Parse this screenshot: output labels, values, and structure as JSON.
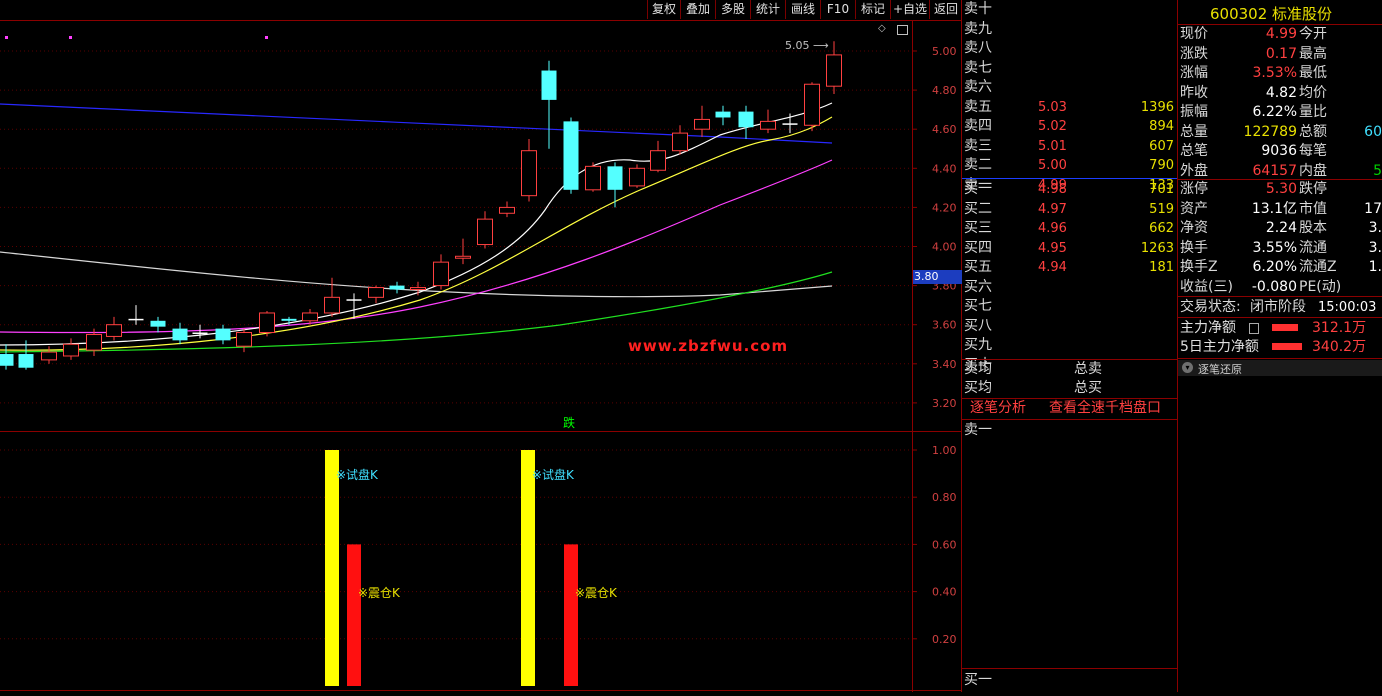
{
  "toolbar": {
    "buttons": [
      "复权",
      "叠加",
      "多股",
      "统计",
      "画线",
      "F10",
      "标记",
      "+自选",
      "返回"
    ]
  },
  "main_chart": {
    "price_axis": [
      "5.00",
      "4.80",
      "4.60",
      "4.40",
      "4.20",
      "4.00",
      "3.80",
      "3.60",
      "3.40",
      "3.20"
    ],
    "current_price_tag": "3.80",
    "high_annotation": "5.05",
    "watermark": "www.zbzfwu.com",
    "marker_text": "跌"
  },
  "indicator": {
    "axis": [
      "1.00",
      "0.80",
      "0.60",
      "0.40",
      "0.20"
    ],
    "label_trial": "※试盘K",
    "label_shake": "※震仓K"
  },
  "order_book": {
    "sell_empty": [
      "卖十",
      "卖九",
      "卖八",
      "卖七",
      "卖六"
    ],
    "sells": [
      {
        "label": "卖五",
        "price": "5.03",
        "vol": "1396"
      },
      {
        "label": "卖四",
        "price": "5.02",
        "vol": "894"
      },
      {
        "label": "卖三",
        "price": "5.01",
        "vol": "607"
      },
      {
        "label": "卖二",
        "price": "5.00",
        "vol": "790"
      },
      {
        "label": "卖一",
        "price": "4.99",
        "vol": "133"
      }
    ],
    "buys": [
      {
        "label": "买一",
        "price": "4.98",
        "vol": "701"
      },
      {
        "label": "买二",
        "price": "4.97",
        "vol": "519"
      },
      {
        "label": "买三",
        "price": "4.96",
        "vol": "662"
      },
      {
        "label": "买四",
        "price": "4.95",
        "vol": "1263"
      },
      {
        "label": "买五",
        "price": "4.94",
        "vol": "181"
      }
    ],
    "buy_empty": [
      "买六",
      "买七",
      "买八",
      "买九",
      "买十"
    ],
    "avg_sell": "卖均",
    "total_sell": "总卖",
    "avg_buy": "买均",
    "total_buy": "总买",
    "tab_tick_analysis": "逐笔分析",
    "tab_full_depth": "查看全速千档盘口",
    "sub_sell1": "卖一",
    "sub_buy1": "买一"
  },
  "quote": {
    "code": "600302",
    "name": "标准股份",
    "rows": [
      {
        "l1": "现价",
        "v1": "4.99",
        "c1": "red",
        "l2": "今开",
        "v2": ""
      },
      {
        "l1": "涨跌",
        "v1": "0.17",
        "c1": "red",
        "l2": "最高",
        "v2": ""
      },
      {
        "l1": "涨幅",
        "v1": "3.53%",
        "c1": "red",
        "l2": "最低",
        "v2": ""
      },
      {
        "l1": "昨收",
        "v1": "4.82",
        "c1": "wht",
        "l2": "均价",
        "v2": ""
      },
      {
        "l1": "振幅",
        "v1": "6.22%",
        "c1": "wht",
        "l2": "量比",
        "v2": ""
      },
      {
        "l1": "总量",
        "v1": "122789",
        "c1": "yel",
        "l2": "总额",
        "v2": "60",
        "c2": "cy"
      },
      {
        "l1": "总笔",
        "v1": "9036",
        "c1": "wht",
        "l2": "每笔",
        "v2": ""
      },
      {
        "l1": "外盘",
        "v1": "64157",
        "c1": "red",
        "l2": "内盘",
        "v2": "5",
        "c2": "grn"
      }
    ],
    "rows2": [
      {
        "l1": "涨停",
        "v1": "5.30",
        "c1": "red",
        "l2": "跌停",
        "v2": ""
      },
      {
        "l1": "资产",
        "v1": "13.1亿",
        "c1": "wht",
        "l2": "市值",
        "v2": "17"
      },
      {
        "l1": "净资",
        "v1": "2.24",
        "c1": "wht",
        "l2": "股本",
        "v2": "3."
      },
      {
        "l1": "换手",
        "v1": "3.55%",
        "c1": "wht",
        "l2": "流通",
        "v2": "3."
      },
      {
        "l1": "换手Z",
        "v1": "6.20%",
        "c1": "wht",
        "l2": "流通Z",
        "v2": "1."
      },
      {
        "l1": "收益(三)",
        "v1": "-0.080",
        "c1": "wht",
        "l2": "PE(动)",
        "v2": ""
      }
    ],
    "trade_status_label": "交易状态:",
    "trade_status": "闭市阶段",
    "trade_time": "15:00:03",
    "main_net_label": "主力净额",
    "main_net": "312.1万",
    "main_net5_label": "5日主力净额",
    "main_net5": "340.2万",
    "tick_restore": "逐笔还原"
  }
}
